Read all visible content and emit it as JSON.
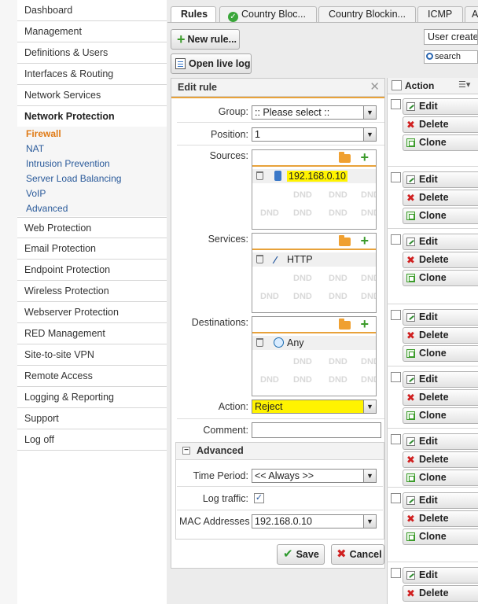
{
  "sidebar": {
    "items": [
      {
        "label": "Dashboard"
      },
      {
        "label": "Management"
      },
      {
        "label": "Definitions & Users"
      },
      {
        "label": "Interfaces & Routing"
      },
      {
        "label": "Network Services"
      },
      {
        "label": "Network Protection"
      }
    ],
    "subitems": [
      {
        "label": "Firewall"
      },
      {
        "label": "NAT"
      },
      {
        "label": "Intrusion Prevention"
      },
      {
        "label": "Server Load Balancing"
      },
      {
        "label": "VoIP"
      },
      {
        "label": "Advanced"
      }
    ],
    "items_after": [
      {
        "label": "Web Protection"
      },
      {
        "label": "Email Protection"
      },
      {
        "label": "Endpoint Protection"
      },
      {
        "label": "Wireless Protection"
      },
      {
        "label": "Webserver Protection"
      },
      {
        "label": "RED Management"
      },
      {
        "label": "Site-to-site VPN"
      },
      {
        "label": "Remote Access"
      },
      {
        "label": "Logging & Reporting"
      },
      {
        "label": "Support"
      },
      {
        "label": "Log off"
      }
    ]
  },
  "tabs": [
    {
      "label": "Rules"
    },
    {
      "label": "Country Bloc..."
    },
    {
      "label": "Country Blockin..."
    },
    {
      "label": "ICMP"
    },
    {
      "label": "A"
    }
  ],
  "toolbar": {
    "new_rule": "New rule...",
    "open_live_log": "Open live log",
    "user_created": "User create",
    "search_placeholder": "search"
  },
  "edit_rule": {
    "title": "Edit rule",
    "close": "✕",
    "group_label": "Group:",
    "group_value": ":: Please select ::",
    "position_label": "Position:",
    "position_value": "1",
    "sources_label": "Sources:",
    "source_item": "192.168.0.10",
    "services_label": "Services:",
    "service_item": "HTTP",
    "destinations_label": "Destinations:",
    "destination_item": "Any",
    "dnd": "DND",
    "action_label": "Action:",
    "action_value": "Reject",
    "comment_label": "Comment:",
    "advanced": {
      "title": "Advanced",
      "collapse": "−",
      "time_period_label": "Time Period:",
      "time_period_value": "<< Always >>",
      "log_traffic_label": "Log traffic:",
      "log_traffic_checked": true,
      "mac_label": "MAC Addresses",
      "mac_value": "192.168.0.10"
    },
    "save": "Save",
    "cancel": "Cancel"
  },
  "rules_list": {
    "header": "Action",
    "edit": "Edit",
    "delete": "Delete",
    "clone": "Clone"
  },
  "colors": {
    "active_nav": "#e07b16",
    "highlight": "#fff300",
    "accent_orange": "#e8a23a",
    "link_blue": "#2a5a9a"
  }
}
